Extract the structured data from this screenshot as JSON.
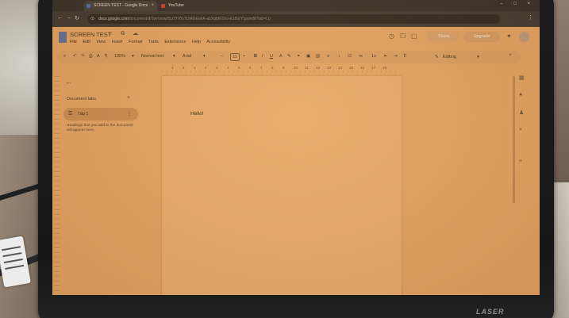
{
  "browser": {
    "tabs": [
      {
        "label": "SCREEN TEST - Google Docs",
        "favicon_color": "#4e6aa8",
        "active": true
      },
      {
        "label": "YouTube",
        "favicon_color": "#d8332a",
        "active": false
      }
    ],
    "url_host": "docs.google.com",
    "url_path": "/document/d/1wrnmwr8zzYhYlsTDMGEuhA-abXpbfEOrs-E1BJrYIps/edit?tab=t.0",
    "controls": "– □ ×"
  },
  "docs": {
    "title": "SCREEN TEST",
    "title_icons": "☆ ⧉ ☁",
    "menu": [
      "File",
      "Edit",
      "View",
      "Insert",
      "Format",
      "Tools",
      "Extensions",
      "Help",
      "Accessibility"
    ],
    "share_label": "Share",
    "upgrade_label": "Upgrade",
    "toolbar": {
      "zoom": "100%",
      "style": "Normal text",
      "font": "Arial",
      "font_size": "11",
      "mode": "Editing"
    },
    "ruler_numbers": [
      "1",
      "2",
      "1",
      "2",
      "3",
      "4",
      "5",
      "6",
      "7",
      "8",
      "9",
      "10",
      "11",
      "12",
      "13",
      "14",
      "15",
      "16",
      "17",
      "18"
    ],
    "sidebar": {
      "panel_title": "Document tabs",
      "tab_label": "Tab 1",
      "hint": "Headings that you add to the document will appear here."
    },
    "body_text": "Hello!"
  },
  "device": {
    "brand": "LASER"
  },
  "colors": {
    "screen_tint": "#e2a362",
    "bezel": "#1c1c1c"
  }
}
